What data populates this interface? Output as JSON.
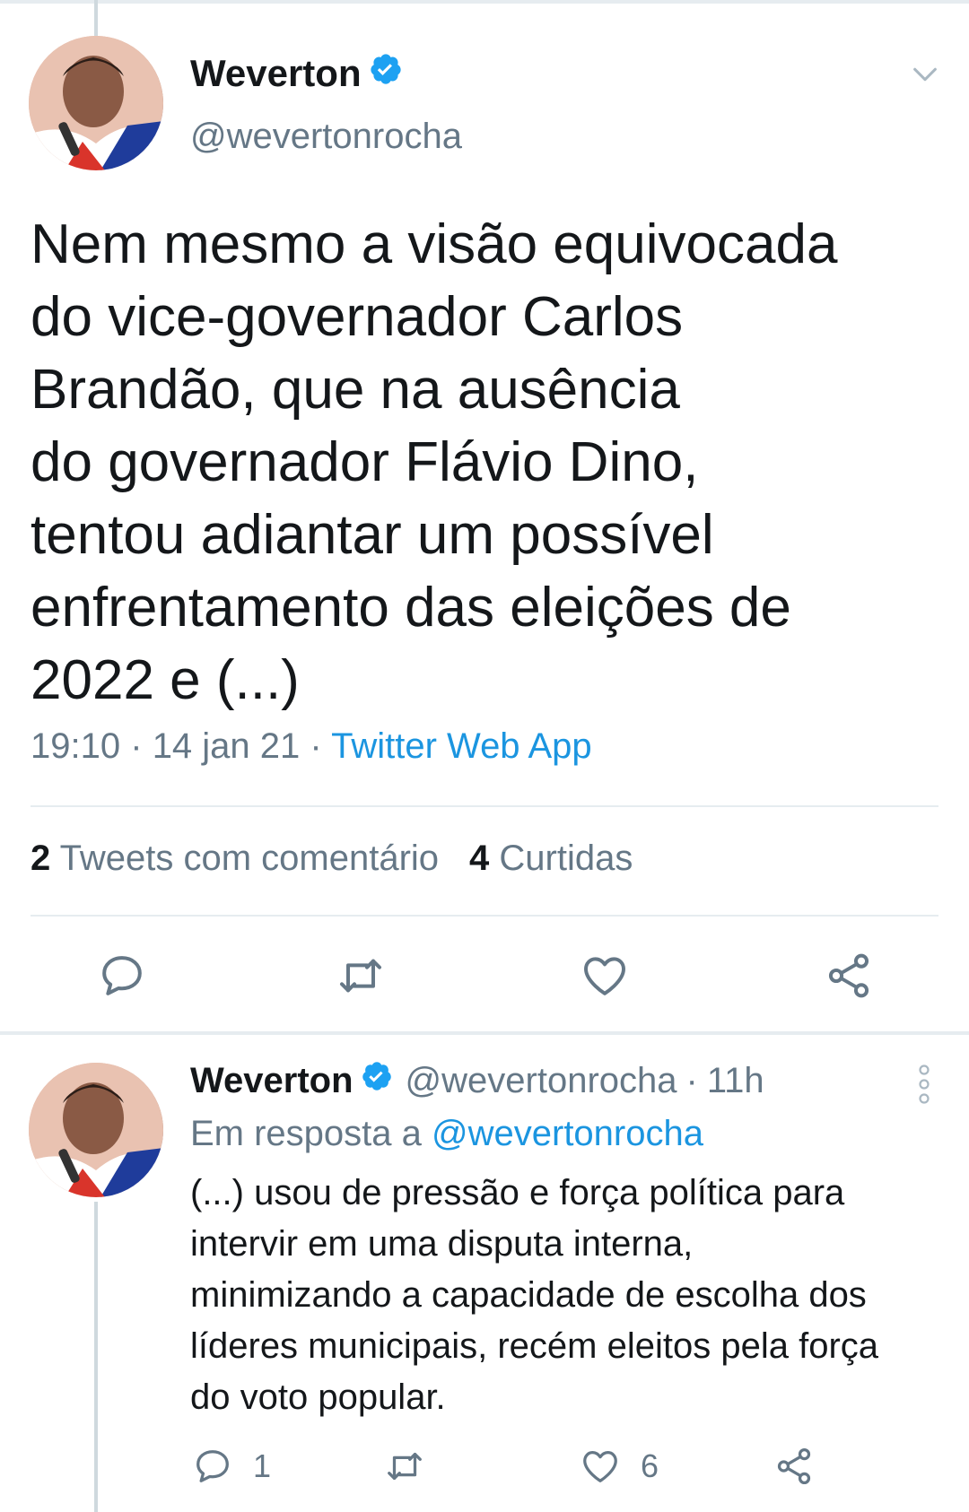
{
  "main_tweet": {
    "display_name": "Weverton",
    "handle": "@wevertonrocha",
    "text": "Nem mesmo a visão equivocada\ndo vice-governador Carlos\nBrandão, que na ausência\ndo governador Flávio Dino,\ntentou adiantar um possível\nenfrentamento das eleições de\n2022 e (...)",
    "time": "19:10",
    "date": "14 jan 21",
    "separator": "·",
    "source": "Twitter Web App",
    "stats": {
      "quote_count": "2",
      "quote_label": "Tweets com comentário",
      "like_count": "4",
      "like_label": "Curtidas"
    }
  },
  "reply_tweet": {
    "display_name": "Weverton",
    "handle": "@wevertonrocha",
    "age": "11h",
    "reply_prefix": "Em resposta a",
    "reply_mention": "@wevertonrocha",
    "text": "(...) usou de pressão e força política para\nintervir em uma disputa interna,\nminimizando a capacidade de escolha dos\nlíderes municipais, recém eleitos pela força\ndo voto popular.",
    "reply_count": "1",
    "like_count": "6"
  },
  "colors": {
    "accent": "#1b95e0",
    "secondary_text": "#657786",
    "primary_text": "#14171a",
    "divider": "#e6ecf0"
  },
  "icons": [
    "verified-badge-icon",
    "chevron-down-icon",
    "reply-icon",
    "retweet-icon",
    "like-icon",
    "share-icon",
    "more-vertical-icon"
  ]
}
